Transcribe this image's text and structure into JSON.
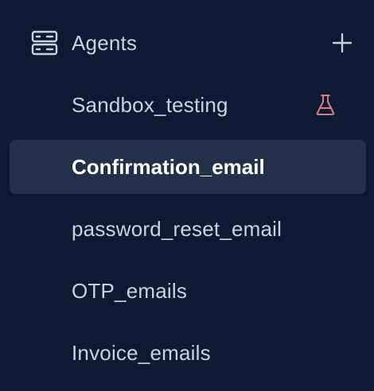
{
  "sidebar": {
    "header": {
      "title": "Agents",
      "icon": "server-icon",
      "add_icon": "plus-icon"
    },
    "items": [
      {
        "label": "Sandbox_testing",
        "badge_icon": "flask-icon",
        "badge_color": "#e07a7a",
        "active": false
      },
      {
        "label": "Confirmation_email",
        "active": true
      },
      {
        "label": "password_reset_email",
        "active": false
      },
      {
        "label": "OTP_emails",
        "active": false
      },
      {
        "label": "Invoice_emails",
        "active": false
      }
    ]
  },
  "colors": {
    "background": "#0d1a33",
    "active_background": "#213149",
    "text": "#c9d2de",
    "active_text": "#ffffff",
    "badge": "#e07a7a"
  }
}
